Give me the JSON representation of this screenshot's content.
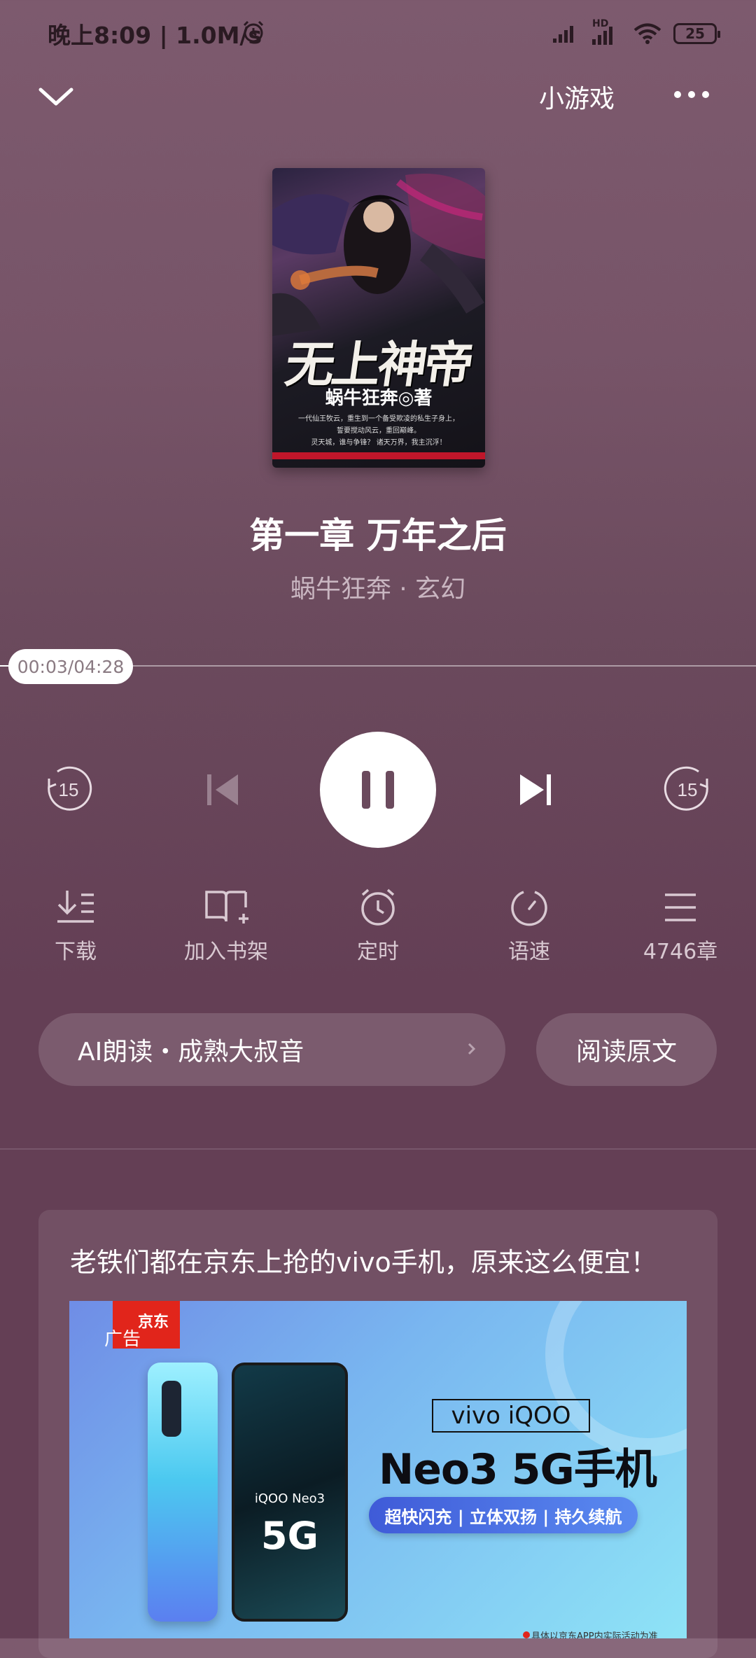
{
  "status_bar": {
    "time": "晚上8:09 | 1.0M/s",
    "network_label": "HD",
    "battery": "25"
  },
  "nav": {
    "games_label": "小游戏"
  },
  "cover": {
    "title": "无上神帝",
    "author": "蜗牛狂奔◎著",
    "blurb_line1": "一代仙王牧云，重生到一个备受欺凌的私生子身上，",
    "blurb_line2": "誓要搅动风云，重回巅峰。",
    "blurb_line3": "灵天城，谁与争锋？ 诸天万界，我主沉浮！"
  },
  "chapter": {
    "title": "第一章 万年之后",
    "meta": "蜗牛狂奔 · 玄幻"
  },
  "player": {
    "time": "00:03/04:28",
    "progress": 0.011,
    "rewind_seconds": "15",
    "forward_seconds": "15"
  },
  "tools": {
    "download": "下载",
    "add_shelf": "加入书架",
    "timer": "定时",
    "speed": "语速",
    "chapters": "4746章"
  },
  "voice": {
    "label": "AI朗读・成熟大叔音",
    "read_original": "阅读原文"
  },
  "ad": {
    "headline": "老铁们都在京东上抢的vivo手机，原来这么便宜！",
    "logo": "京东",
    "tag": "广告",
    "phone_brand": "iQOO Neo3",
    "phone_5g": "5G",
    "model_box": "vivo iQOO",
    "model_big": "Neo3 5G手机",
    "features": "超快闪充 | 立体双扬 | 持久续航",
    "footer": "具体以京东APP内实际活动为准"
  },
  "colors": {
    "background": "#6b4a5d",
    "accent_white": "#ffffff",
    "jd_red": "#e1251b"
  }
}
